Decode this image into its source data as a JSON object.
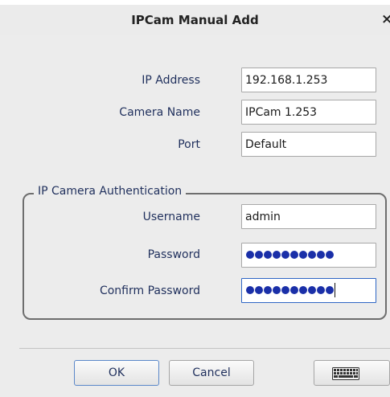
{
  "window": {
    "title": "IPCam Manual Add",
    "close_glyph": "×"
  },
  "form": {
    "ip_address": {
      "label": "IP Address",
      "value": "192.168.1.253"
    },
    "camera_name": {
      "label": "Camera Name",
      "value": "IPCam 1.253"
    },
    "port": {
      "label": "Port",
      "value": "Default"
    }
  },
  "auth": {
    "legend": "IP Camera Authentication",
    "username": {
      "label": "Username",
      "value": "admin"
    },
    "password": {
      "label": "Password",
      "masked_length": 10
    },
    "confirm_password": {
      "label": "Confirm Password",
      "masked_length": 10
    }
  },
  "buttons": {
    "ok": "OK",
    "cancel": "Cancel",
    "keyboard_icon": "keyboard-icon"
  },
  "colors": {
    "accent": "#2f66c4",
    "mask_dot": "#1a2fa8"
  }
}
